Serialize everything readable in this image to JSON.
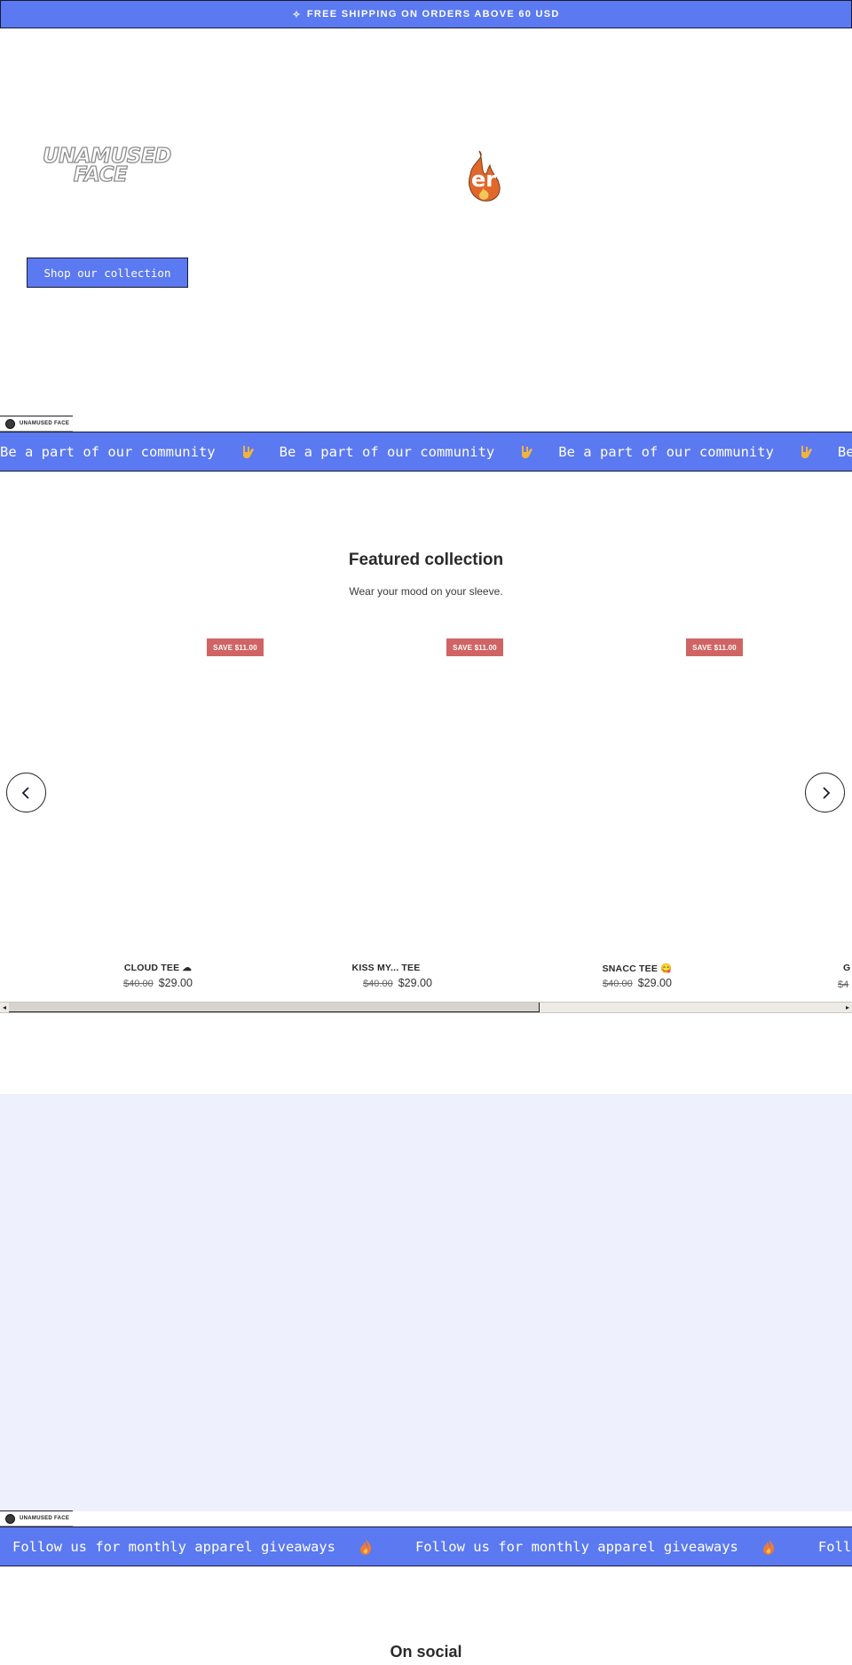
{
  "announcement": {
    "text": "FREE SHIPPING ON ORDERS ABOVE 60 USD",
    "icon": "sparkle-icon"
  },
  "hero": {
    "logo_line1": "UNAMUSED",
    "logo_line2": "FACE",
    "emblem": "flame-emblem-icon",
    "cta_label": "Shop our collection"
  },
  "community_band": {
    "tag_label": "UNAMUSED FACE",
    "text": "Be a part of our community",
    "emoji": "rock-on-hand-icon"
  },
  "featured": {
    "title": "Featured collection",
    "subtitle": "Wear your mood on your sleeve."
  },
  "products": [
    {
      "name": "CLOUD TEE ☁",
      "badge": "SAVE $11.00",
      "old_price": "$40.00",
      "price": "$29.00"
    },
    {
      "name": "KISS MY... TEE",
      "badge": "SAVE $11.00",
      "old_price": "$40.00",
      "price": "$29.00"
    },
    {
      "name": "SNACC TEE 😋",
      "badge": "SAVE $11.00",
      "old_price": "$40.00",
      "price": "$29.00"
    },
    {
      "name": "G",
      "badge": "",
      "old_price": "$4",
      "price": ""
    }
  ],
  "carousel": {
    "prev_icon": "chevron-left-icon",
    "next_icon": "chevron-right-icon"
  },
  "giveaway_band": {
    "tag_label": "UNAMUSED FACE",
    "text": "Follow us for monthly apparel giveaways",
    "emoji": "fire-icon"
  },
  "social": {
    "title": "On social"
  },
  "colors": {
    "accent": "#5b79f0",
    "sale": "#d06464",
    "lavender": "#eef0fe",
    "ink": "#1b1b2e"
  }
}
